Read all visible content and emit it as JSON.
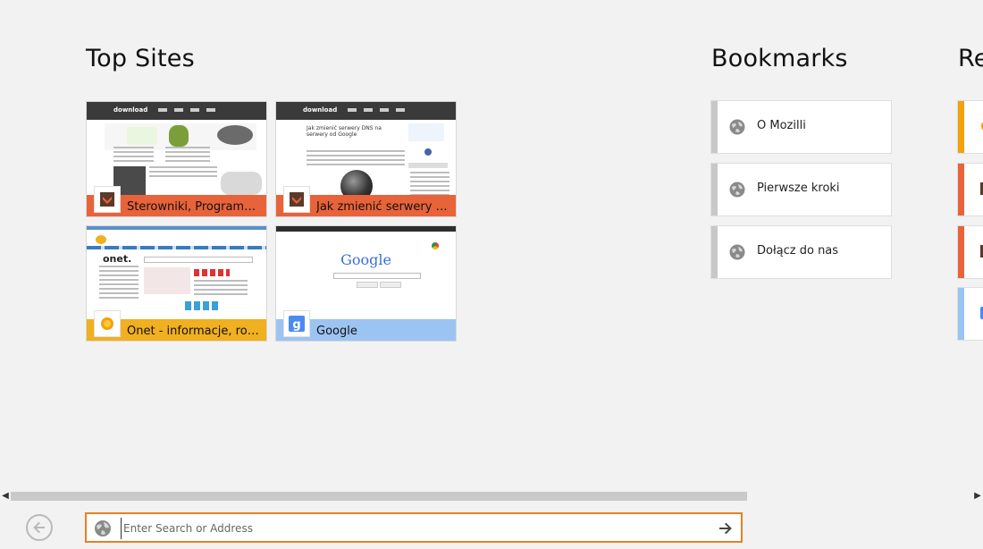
{
  "sections": {
    "top_sites": "Top Sites",
    "bookmarks": "Bookmarks",
    "recent": "Re"
  },
  "top_sites": [
    {
      "label": "Sterowniki, Programy, G...",
      "color": "#e8633a",
      "icon": "download-logo-icon"
    },
    {
      "label": "Jak zmienić serwery DN...",
      "color": "#e8633a",
      "icon": "download-logo-icon"
    },
    {
      "label": "Onet - informacje, rozry...",
      "color": "#f0b020",
      "icon": "onet-logo-icon"
    },
    {
      "label": "Google",
      "color": "#9cc4f2",
      "icon": "google-g-icon"
    }
  ],
  "thumbs": {
    "google_logo": "Google",
    "onet_logo": "onet.",
    "article_title": "Jak zmienić serwery DNS na serwery od Google",
    "download_logo": "download"
  },
  "bookmarks": [
    {
      "label": "O Mozilli",
      "icon": "globe-icon"
    },
    {
      "label": "Pierwsze kroki",
      "icon": "globe-icon"
    },
    {
      "label": "Dołącz do nas",
      "icon": "globe-icon"
    }
  ],
  "recent_colors": [
    "#f2a20c",
    "#e8633a",
    "#e8633a",
    "#9cc4f2"
  ],
  "address_bar": {
    "placeholder": "Enter Search or Address"
  },
  "colors": {
    "accent": "#e9801f",
    "background": "#f2f2f2"
  }
}
